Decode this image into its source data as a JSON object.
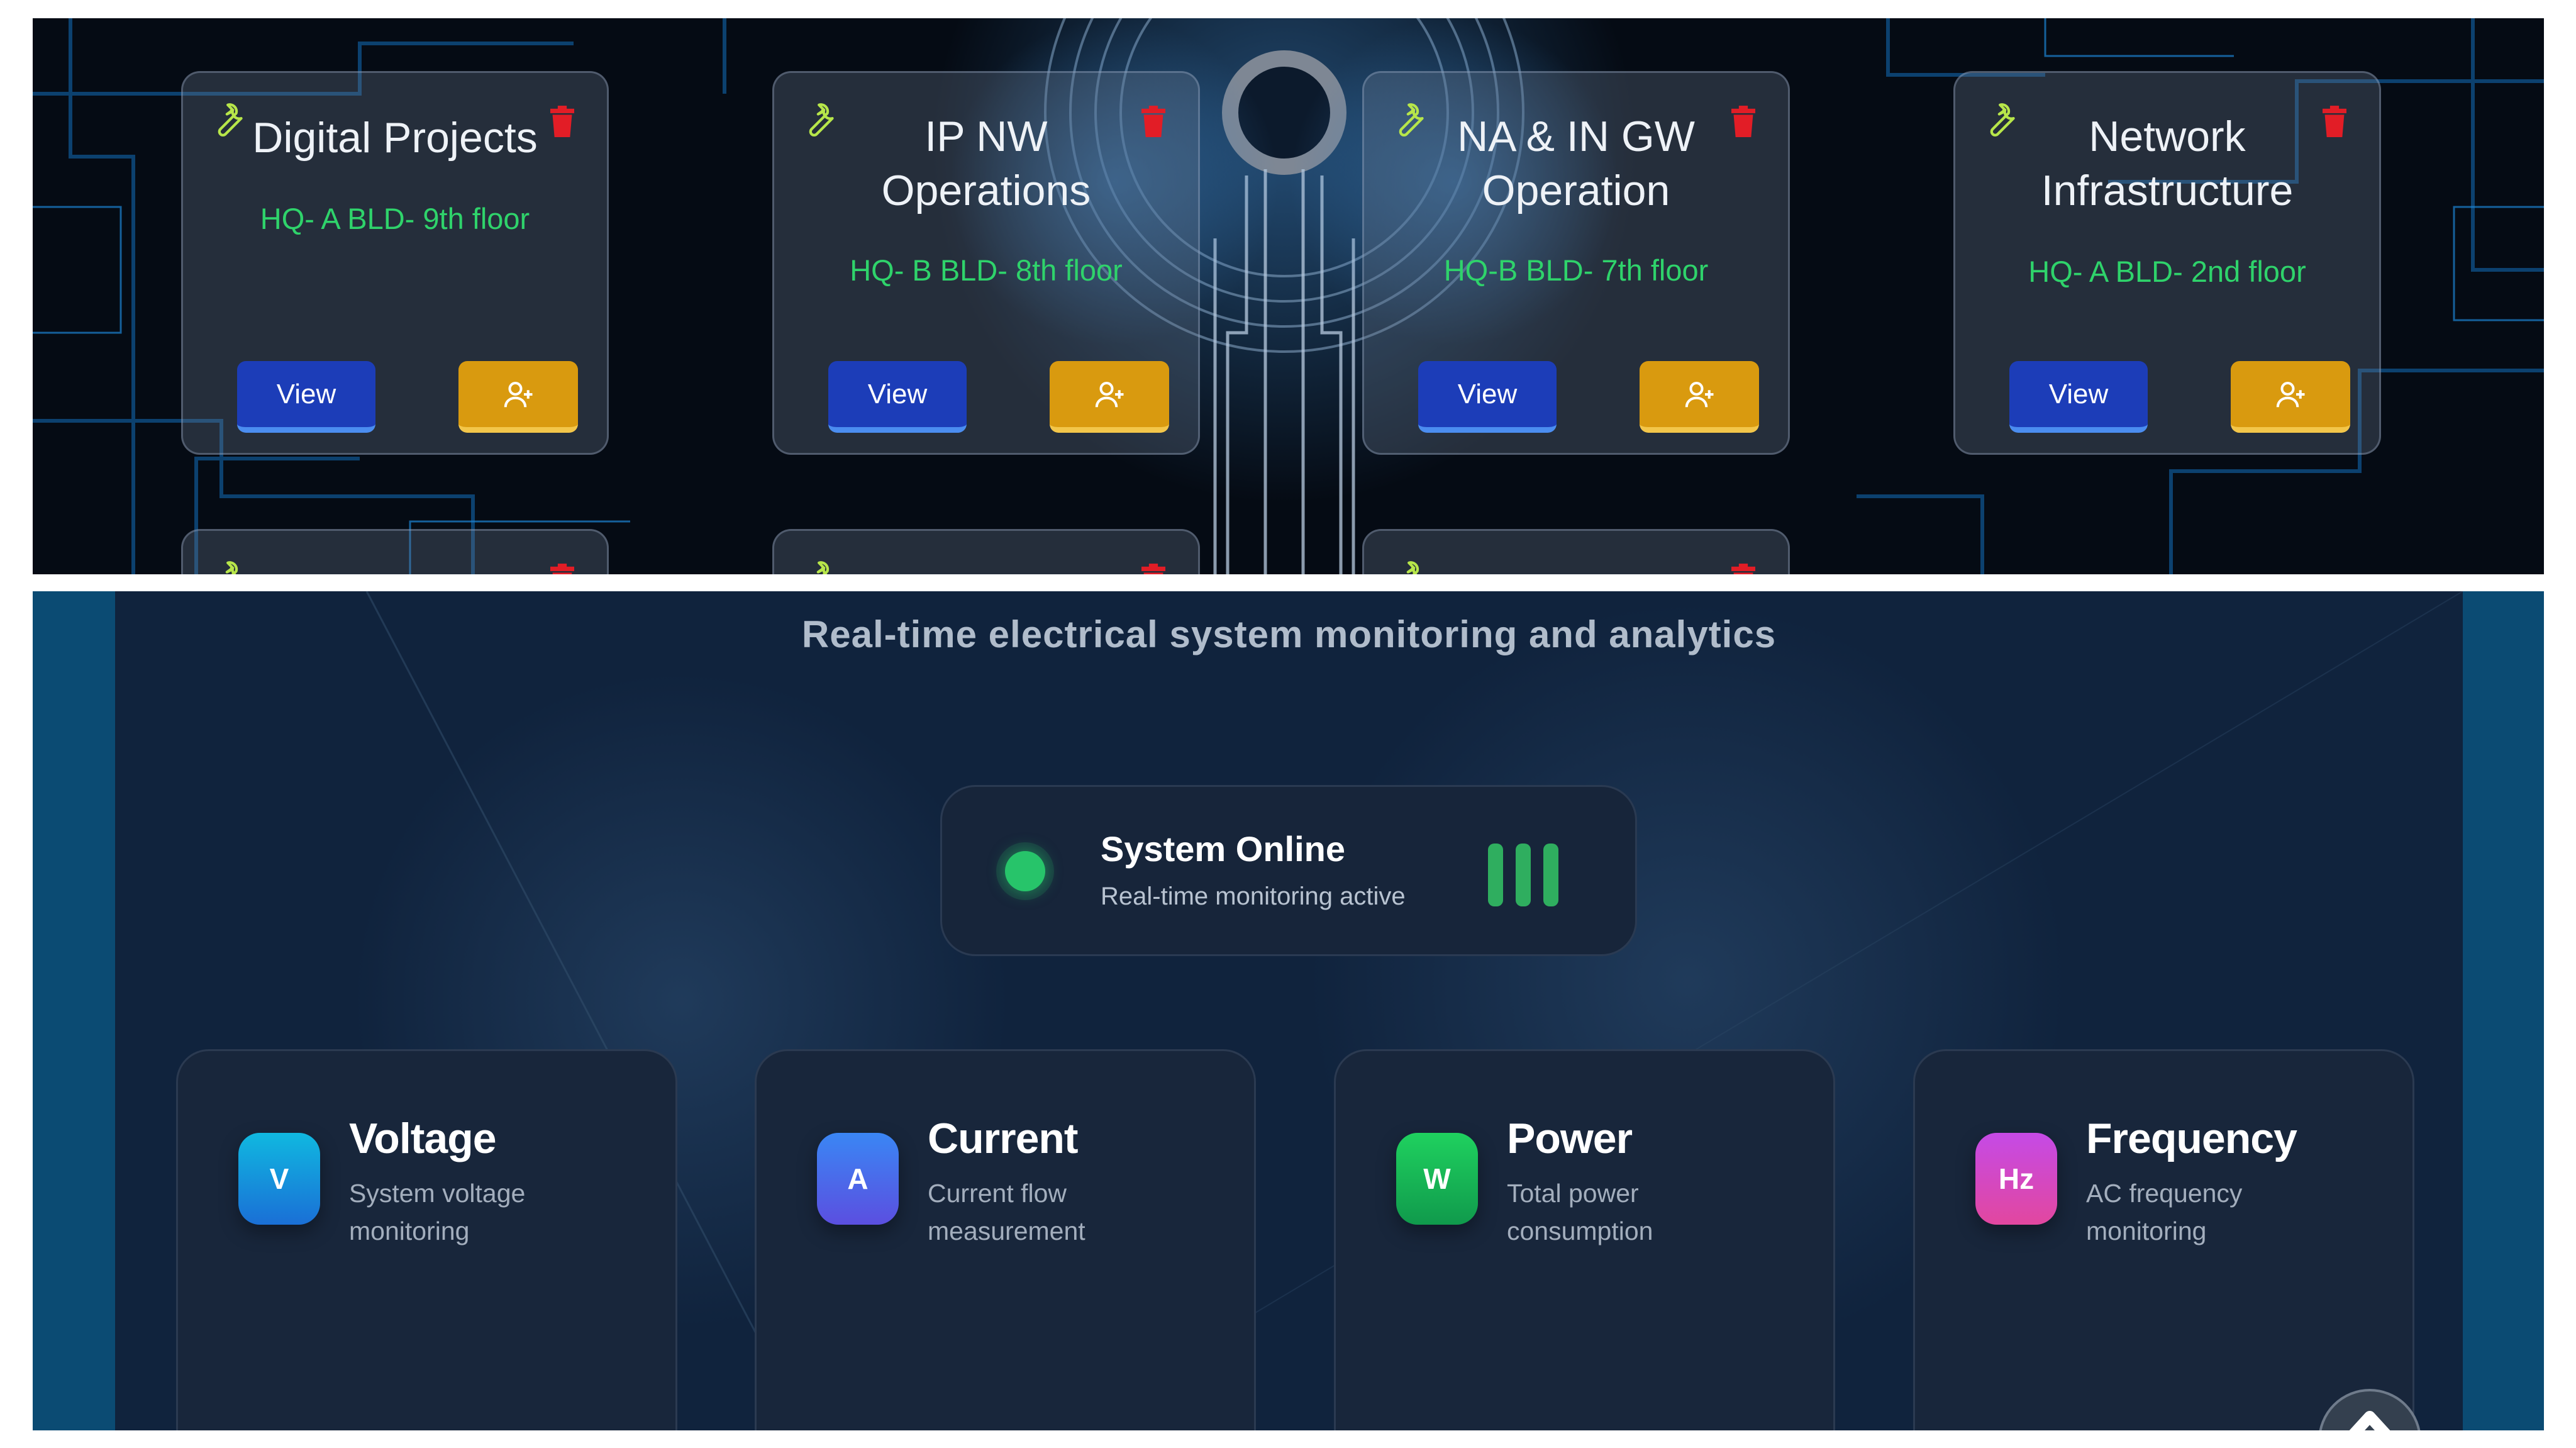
{
  "rooms": [
    {
      "name": "Digital Projects",
      "location": "HQ- A BLD- 9th floor",
      "view_label": "View"
    },
    {
      "name": "IP NW Operations",
      "location": "HQ- B BLD- 8th floor",
      "view_label": "View"
    },
    {
      "name": "NA & IN GW Operation",
      "location": "HQ-B BLD- 7th floor",
      "view_label": "View"
    },
    {
      "name": "Network Infrastructure",
      "location": "HQ- A BLD- 2nd floor",
      "view_label": "View"
    }
  ],
  "icons": {
    "edit": "wrench-icon",
    "delete": "trash-icon",
    "assign": "user-plus-icon",
    "status": "status-dot-icon",
    "scroll": "chevron-up-icon"
  },
  "monitoring": {
    "subtitle": "Real-time electrical system monitoring and analytics",
    "status": {
      "title": "System Online",
      "subtitle": "Real-time monitoring active"
    },
    "metrics": [
      {
        "badge": "V",
        "title": "Voltage",
        "description": "System voltage monitoring",
        "color_from": "#10b8e0",
        "color_to": "#1a6fd6"
      },
      {
        "badge": "A",
        "title": "Current",
        "description": "Current flow measurement",
        "color_from": "#3a86f4",
        "color_to": "#5b4fe0"
      },
      {
        "badge": "W",
        "title": "Power",
        "description": "Total power consumption",
        "color_from": "#1fd15f",
        "color_to": "#109a4c"
      },
      {
        "badge": "Hz",
        "title": "Frequency",
        "description": "AC frequency monitoring",
        "color_from": "#c54ae6",
        "color_to": "#e2479f"
      }
    ]
  },
  "colors": {
    "view_button": "#1c3db8",
    "assign_button": "#d99a0f",
    "location_text": "#2fd36b",
    "delete_icon": "#e21d26",
    "edit_icon": "#b7e64a",
    "online": "#27c46a"
  }
}
